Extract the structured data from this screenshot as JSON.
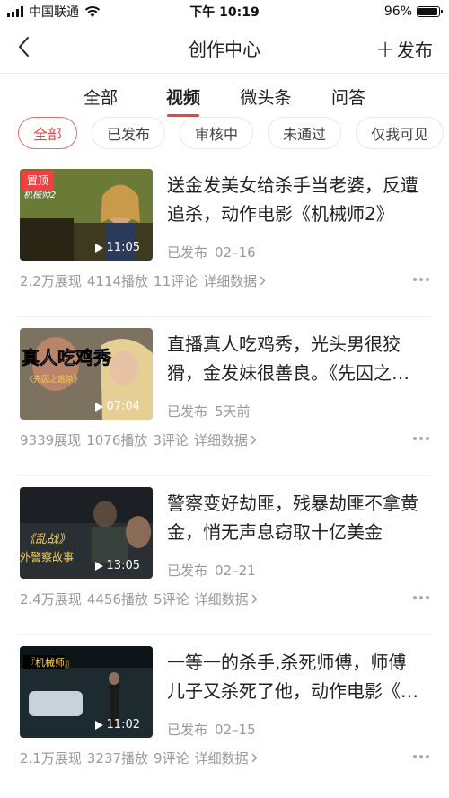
{
  "status_bar": {
    "carrier": "中国联通",
    "time": "下午 10:19",
    "battery": "96%",
    "battery_level": 0.96
  },
  "nav": {
    "title": "创作中心",
    "publish_label": "发布"
  },
  "tabs": [
    {
      "label": "全部",
      "active": false
    },
    {
      "label": "视频",
      "active": true
    },
    {
      "label": "微头条",
      "active": false
    },
    {
      "label": "问答",
      "active": false
    }
  ],
  "filters": [
    {
      "label": "全部",
      "active": true
    },
    {
      "label": "已发布",
      "active": false
    },
    {
      "label": "审核中",
      "active": false
    },
    {
      "label": "未通过",
      "active": false
    },
    {
      "label": "仅我可见",
      "active": false
    }
  ],
  "videos": [
    {
      "pinned": true,
      "pin_label": "置顶",
      "duration": "11:05",
      "title": "送金发美女给杀手当老婆，反遭追杀，动作电影《机械师2》",
      "status": "已发布",
      "date": "02–16",
      "impressions": "2.2万展现",
      "plays": "4114播放",
      "comments": "11评论",
      "detail": "详细数据"
    },
    {
      "pinned": false,
      "duration": "07:04",
      "title": "直播真人吃鸡秀，光头男很狡猾，金发妹很善良。《先囚之逃杀》",
      "status": "已发布",
      "date": "5天前",
      "impressions": "9339展现",
      "plays": "1076播放",
      "comments": "3评论",
      "detail": "详细数据"
    },
    {
      "pinned": false,
      "duration": "13:05",
      "title": "警察变好劫匪，残暴劫匪不拿黄金，悄无声息窃取十亿美金",
      "status": "已发布",
      "date": "02–21",
      "impressions": "2.4万展现",
      "plays": "4456播放",
      "comments": "5评论",
      "detail": "详细数据"
    },
    {
      "pinned": false,
      "duration": "11:02",
      "title": "一等一的杀手,杀死师傅，师傅儿子又杀死了他，动作电影《机械师》",
      "status": "已发布",
      "date": "02–15",
      "impressions": "2.1万展现",
      "plays": "3237播放",
      "comments": "9评论",
      "detail": "详细数据"
    }
  ],
  "colors": {
    "accent": "#f04142"
  }
}
